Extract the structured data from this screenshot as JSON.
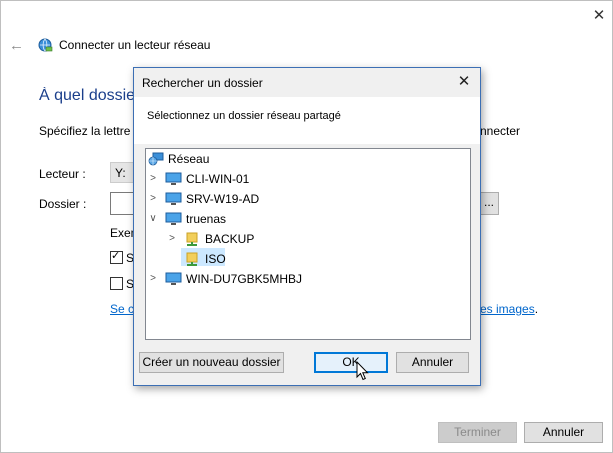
{
  "wizard": {
    "title": "Connecter un lecteur réseau",
    "question": "À quel dossier réseau voulez-vous vous connecter ?",
    "specify_start": "Spécifiez la lettre",
    "specify_end": "nnecter :",
    "drive_label": "Lecteur :",
    "drive_value": "Y:",
    "folder_label": "Dossier :",
    "folder_value": "",
    "browse_label": "...",
    "example": "Exemple",
    "checkbox1": "S",
    "checkbox2": "S",
    "link_start": "Se c",
    "link_end_link": "es images",
    "link_end_dot": ".",
    "finish_button": "Terminer",
    "cancel_button": "Annuler"
  },
  "dialog": {
    "title": "Rechercher un dossier",
    "instruction": "Sélectionnez un dossier réseau partagé",
    "tree": {
      "root": "Réseau",
      "computers": [
        "CLI-WIN-01",
        "SRV-W19-AD",
        "truenas",
        "WIN-DU7GBK5MHBJ"
      ],
      "shares": [
        "BACKUP",
        "ISO"
      ],
      "selected": "ISO"
    },
    "new_folder_button": "Créer un nouveau dossier",
    "ok_button": "OK",
    "cancel_button": "Annuler"
  },
  "colors": {
    "accent": "#0078d7",
    "heading_blue": "#1b3f8b",
    "link": "#0066cc",
    "selection": "#cce8ff"
  }
}
